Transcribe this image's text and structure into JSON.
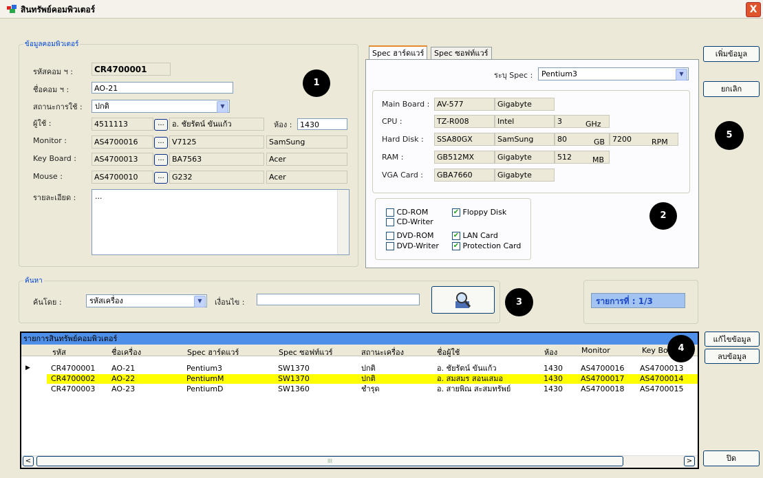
{
  "window": {
    "title": "สินทรัพย์คอมพิวเตอร์",
    "close": "X"
  },
  "computer_group": {
    "label": "ข้อมูลคอมพิวเตอร์",
    "code_label": "รหัสคอม ฯ :",
    "code_value": "CR4700001",
    "name_label": "ชื่อคอม ฯ :",
    "name_value": "AO-21",
    "status_label": "สถานะการใช้ :",
    "status_value": "ปกติ",
    "user_label": "ผู้ใช้ :",
    "user_id": "4511113",
    "user_name": "อ. ชัยรัตน์ ขันแก้ว",
    "room_label": "ห้อง :",
    "room_value": "1430",
    "monitor_label": "Monitor :",
    "monitor_id": "AS4700016",
    "monitor_model": "V7125",
    "monitor_brand": "SamSung",
    "keyboard_label": "Key Board :",
    "keyboard_id": "AS4700013",
    "keyboard_model": "BA7563",
    "keyboard_brand": "Acer",
    "mouse_label": "Mouse :",
    "mouse_id": "AS4700010",
    "mouse_model": "G232",
    "mouse_brand": "Acer",
    "detail_label": "รายละเอียด :",
    "detail_value": "...",
    "dots": "..."
  },
  "spec": {
    "tab_hw": "Spec ฮาร์ดแวร์",
    "tab_sw": "Spec ซอฟท์แวร์",
    "select_label": "ระบุ Spec :",
    "select_value": "Pentium3",
    "mainboard_label": "Main Board :",
    "mainboard_model": "AV-577",
    "mainboard_brand": "Gigabyte",
    "cpu_label": "CPU :",
    "cpu_model": "TZ-R008",
    "cpu_brand": "Intel",
    "cpu_speed": "3",
    "cpu_unit": "GHz",
    "hdd_label": "Hard Disk :",
    "hdd_model": "SSA80GX",
    "hdd_brand": "SamSung",
    "hdd_size": "80",
    "hdd_unit": "GB",
    "hdd_rpm": "7200",
    "hdd_rpm_unit": "RPM",
    "ram_label": "RAM :",
    "ram_model": "GB512MX",
    "ram_brand": "Gigabyte",
    "ram_size": "512",
    "ram_unit": "MB",
    "vga_label": "VGA Card :",
    "vga_model": "GBA7660",
    "vga_brand": "Gigabyte"
  },
  "devices": [
    {
      "label": "CD-ROM",
      "checked": false
    },
    {
      "label": "CD-Writer",
      "checked": false
    },
    {
      "label": "DVD-ROM",
      "checked": false
    },
    {
      "label": "DVD-Writer",
      "checked": false
    },
    {
      "label": "Floppy Disk",
      "checked": true
    },
    {
      "label": "LAN Card",
      "checked": true
    },
    {
      "label": "Protection Card",
      "checked": true
    }
  ],
  "search": {
    "label": "ค้นหา",
    "by_label": "ค้นโดย :",
    "by_value": "รหัสเครื่อง",
    "cond_label": "เงื่อนไข :",
    "cond_value": ""
  },
  "record": {
    "label": "รายการที่",
    "value": ": 1/3"
  },
  "buttons": {
    "add": "เพิ่มข้อมูล",
    "cancel": "ยกเลิก",
    "edit": "แก้ไขข้อมูล",
    "delete": "ลบข้อมูล",
    "close": "ปิด"
  },
  "callouts": [
    "1",
    "2",
    "3",
    "4",
    "5"
  ],
  "grid": {
    "title": "รายการสินทรัพย์คอมพิวเตอร์",
    "columns": [
      "รหัส",
      "ชื่อเครื่อง",
      "Spec ฮาร์ดแวร์",
      "Spec ซอฟท์แวร์",
      "สถานะเครื่อง",
      "ชื่อผู้ใช้",
      "ห้อง",
      "Monitor",
      "Key Bo"
    ],
    "rows": [
      [
        "CR4700001",
        "AO-21",
        "Pentium3",
        "SW1370",
        "ปกติ",
        "อ. ชัยรัตน์ ขันแก้ว",
        "1430",
        "AS4700016",
        "AS4700013"
      ],
      [
        "CR4700002",
        "AO-22",
        "PentiumM",
        "SW1370",
        "ปกติ",
        "อ. สมสมร สอนเสมอ",
        "1430",
        "AS4700017",
        "AS4700014"
      ],
      [
        "CR4700003",
        "AO-23",
        "PentiumD",
        "SW1360",
        "ชำรุด",
        "อ. สายพิณ สะสมทรัพย์",
        "1430",
        "AS4700018",
        "AS4700015"
      ]
    ],
    "scroll_left": "<",
    "scroll_right": ">",
    "scroll_thumb": "III",
    "row_pointer": "▶"
  },
  "icons": {
    "app": "app-window-icon",
    "search": "search-tool-icon",
    "dropdown": "chevron-down-icon"
  }
}
